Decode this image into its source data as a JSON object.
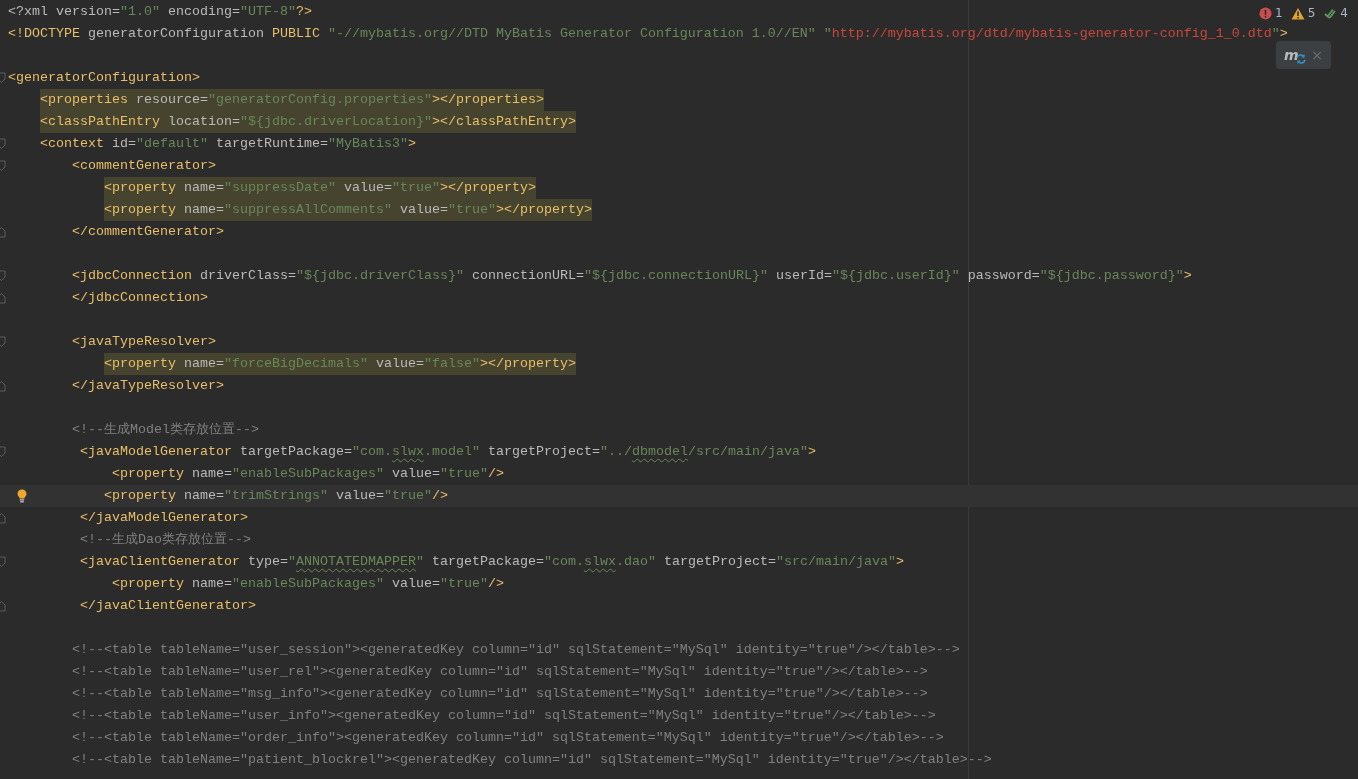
{
  "inspections": [
    {
      "kind": "error",
      "count": "1"
    },
    {
      "kind": "warning",
      "count": "5"
    },
    {
      "kind": "ok",
      "count": "4"
    }
  ],
  "reload_popup": {
    "logo": "m",
    "close": "×"
  },
  "lines": [
    {
      "current": false,
      "highlighted": false,
      "tokens": [
        {
          "kind": "plain",
          "text": "<?xml"
        },
        {
          "kind": "attr",
          "text": " version="
        },
        {
          "kind": "value",
          "text": "\"1.0\""
        },
        {
          "kind": "attr",
          "text": " encoding="
        },
        {
          "kind": "value",
          "text": "\"UTF-8\""
        },
        {
          "kind": "tag",
          "text": "?>"
        }
      ]
    },
    {
      "current": false,
      "highlighted": false,
      "tokens": [
        {
          "kind": "tag",
          "text": "<!DOCTYPE"
        },
        {
          "kind": "plain",
          "text": " generatorConfiguration "
        },
        {
          "kind": "tag",
          "text": "PUBLIC"
        },
        {
          "kind": "value",
          "text": " \"-//mybatis.org//DTD MyBatis Generator Configuration 1.0//EN\" \""
        },
        {
          "kind": "url",
          "text": "http://mybatis.org/dtd/mybatis-generator-config_1_0.dtd"
        },
        {
          "kind": "value",
          "text": "\""
        },
        {
          "kind": "tag",
          "text": ">"
        }
      ]
    },
    {
      "current": false
    },
    {
      "current": false,
      "highlighted": false,
      "fold": {
        "kind": "start"
      },
      "tokens": [
        {
          "kind": "tag",
          "text": "<generatorConfiguration>"
        }
      ]
    },
    {
      "current": false,
      "highlighted": true,
      "tokens": [
        {
          "kind": "tag",
          "text": "    <properties"
        },
        {
          "kind": "attr",
          "text": " resource="
        },
        {
          "kind": "value",
          "text": "\"generatorConfig.properties\""
        },
        {
          "kind": "tag",
          "text": "></properties>"
        }
      ]
    },
    {
      "current": false,
      "highlighted": true,
      "tokens": [
        {
          "kind": "tag",
          "text": "    <classPathEntry"
        },
        {
          "kind": "attr",
          "text": " location="
        },
        {
          "kind": "value",
          "text": "\"${jdbc.driverLocation}\""
        },
        {
          "kind": "tag",
          "text": "></classPathEntry>"
        }
      ]
    },
    {
      "current": false,
      "highlighted": false,
      "fold": {
        "kind": "start"
      },
      "tokens": [
        {
          "kind": "tag",
          "text": "    <context"
        },
        {
          "kind": "attr",
          "text": " id="
        },
        {
          "kind": "value",
          "text": "\"default\""
        },
        {
          "kind": "attr",
          "text": " targetRuntime="
        },
        {
          "kind": "value",
          "text": "\"MyBatis3\""
        },
        {
          "kind": "tag",
          "text": ">"
        }
      ]
    },
    {
      "current": false,
      "highlighted": false,
      "fold": {
        "kind": "start"
      },
      "tokens": [
        {
          "kind": "tag",
          "text": "        <commentGenerator>"
        }
      ]
    },
    {
      "current": false,
      "highlighted": true,
      "tokens": [
        {
          "kind": "tag",
          "text": "            <property"
        },
        {
          "kind": "attr",
          "text": " name="
        },
        {
          "kind": "value",
          "text": "\"suppressDate\""
        },
        {
          "kind": "attr",
          "text": " value="
        },
        {
          "kind": "value",
          "text": "\"true\""
        },
        {
          "kind": "tag",
          "text": "></property>"
        }
      ]
    },
    {
      "current": false,
      "highlighted": true,
      "tokens": [
        {
          "kind": "tag",
          "text": "            <property"
        },
        {
          "kind": "attr",
          "text": " name="
        },
        {
          "kind": "value",
          "text": "\"suppressAllComments\""
        },
        {
          "kind": "attr",
          "text": " value="
        },
        {
          "kind": "value",
          "text": "\"true\""
        },
        {
          "kind": "tag",
          "text": "></property>"
        }
      ]
    },
    {
      "current": false,
      "highlighted": false,
      "fold": {
        "kind": "end"
      },
      "tokens": [
        {
          "kind": "tag",
          "text": "        </commentGenerator>"
        }
      ]
    },
    {
      "current": false
    },
    {
      "current": false,
      "highlighted": false,
      "fold": {
        "kind": "start"
      },
      "tokens": [
        {
          "kind": "tag",
          "text": "        <jdbcConnection"
        },
        {
          "kind": "attr",
          "text": " driverClass="
        },
        {
          "kind": "value",
          "text": "\"${jdbc.driverClass}\""
        },
        {
          "kind": "attr",
          "text": " connectionURL="
        },
        {
          "kind": "value",
          "text": "\"${jdbc.connectionURL}\""
        },
        {
          "kind": "attr",
          "text": " userId="
        },
        {
          "kind": "value",
          "text": "\"${jdbc.userId}\""
        },
        {
          "kind": "attr",
          "text": " password="
        },
        {
          "kind": "value",
          "text": "\"${jdbc.password}\""
        },
        {
          "kind": "tag",
          "text": ">"
        }
      ]
    },
    {
      "current": false,
      "highlighted": false,
      "fold": {
        "kind": "end"
      },
      "tokens": [
        {
          "kind": "tag",
          "text": "        </jdbcConnection>"
        }
      ]
    },
    {
      "current": false
    },
    {
      "current": false,
      "highlighted": false,
      "fold": {
        "kind": "start"
      },
      "tokens": [
        {
          "kind": "tag",
          "text": "        <javaTypeResolver>"
        }
      ]
    },
    {
      "current": false,
      "highlighted": true,
      "tokens": [
        {
          "kind": "tag",
          "text": "            <property"
        },
        {
          "kind": "attr",
          "text": " name="
        },
        {
          "kind": "value",
          "text": "\"forceBigDecimals\""
        },
        {
          "kind": "attr",
          "text": " value="
        },
        {
          "kind": "value",
          "text": "\"false\""
        },
        {
          "kind": "tag",
          "text": "></property>"
        }
      ]
    },
    {
      "current": false,
      "highlighted": false,
      "fold": {
        "kind": "end"
      },
      "tokens": [
        {
          "kind": "tag",
          "text": "        </javaTypeResolver>"
        }
      ]
    },
    {
      "current": false
    },
    {
      "current": false,
      "highlighted": false,
      "tokens": [
        {
          "kind": "comment",
          "text": "        <!--生成Model类存放位置-->"
        }
      ]
    },
    {
      "current": false,
      "highlighted": false,
      "fold": {
        "kind": "start"
      },
      "tokens": [
        {
          "kind": "tag",
          "text": "         <javaModelGenerator"
        },
        {
          "kind": "attr",
          "text": " targetPackage="
        },
        {
          "kind": "value",
          "text": "\"com."
        },
        {
          "kind": "value",
          "text": "slwx",
          "typo": true
        },
        {
          "kind": "value",
          "text": ".model\""
        },
        {
          "kind": "attr",
          "text": " targetProject="
        },
        {
          "kind": "value",
          "text": "\"../"
        },
        {
          "kind": "value",
          "text": "dbmodel",
          "typo": true
        },
        {
          "kind": "value",
          "text": "/src/main/java\""
        },
        {
          "kind": "tag",
          "text": ">"
        }
      ]
    },
    {
      "current": false,
      "highlighted": false,
      "tokens": [
        {
          "kind": "tag",
          "text": "             <property"
        },
        {
          "kind": "attr",
          "text": " name="
        },
        {
          "kind": "value",
          "text": "\"enableSubPackages\""
        },
        {
          "kind": "attr",
          "text": " value="
        },
        {
          "kind": "value",
          "text": "\"true\""
        },
        {
          "kind": "tag",
          "text": "/>"
        }
      ]
    },
    {
      "current": true,
      "highlighted": false,
      "tokens": [
        {
          "kind": "tag",
          "text": "            <property"
        },
        {
          "kind": "attr",
          "text": " name="
        },
        {
          "kind": "value",
          "text": "\"trimStrings\""
        },
        {
          "kind": "attr",
          "text": " value="
        },
        {
          "kind": "value",
          "text": "\"true\""
        },
        {
          "kind": "tag",
          "text": "/>"
        }
      ]
    },
    {
      "current": false,
      "highlighted": false,
      "fold": {
        "kind": "end"
      },
      "tokens": [
        {
          "kind": "tag",
          "text": "         </javaModelGenerator>"
        }
      ]
    },
    {
      "current": false,
      "highlighted": false,
      "tokens": [
        {
          "kind": "comment",
          "text": "         <!--生成Dao类存放位置-->"
        }
      ]
    },
    {
      "current": false,
      "highlighted": false,
      "fold": {
        "kind": "start"
      },
      "tokens": [
        {
          "kind": "tag",
          "text": "         <javaClientGenerator"
        },
        {
          "kind": "attr",
          "text": " type="
        },
        {
          "kind": "value",
          "text": "\""
        },
        {
          "kind": "value",
          "text": "ANNOTATEDMAPPER",
          "typo": true
        },
        {
          "kind": "value",
          "text": "\""
        },
        {
          "kind": "attr",
          "text": " targetPackage="
        },
        {
          "kind": "value",
          "text": "\"com."
        },
        {
          "kind": "value",
          "text": "slwx",
          "typo": true
        },
        {
          "kind": "value",
          "text": ".dao\""
        },
        {
          "kind": "attr",
          "text": " targetProject="
        },
        {
          "kind": "value",
          "text": "\"src/main/java\""
        },
        {
          "kind": "tag",
          "text": ">"
        }
      ]
    },
    {
      "current": false,
      "highlighted": false,
      "tokens": [
        {
          "kind": "tag",
          "text": "             <property"
        },
        {
          "kind": "attr",
          "text": " name="
        },
        {
          "kind": "value",
          "text": "\"enableSubPackages\""
        },
        {
          "kind": "attr",
          "text": " value="
        },
        {
          "kind": "value",
          "text": "\"true\""
        },
        {
          "kind": "tag",
          "text": "/>"
        }
      ]
    },
    {
      "current": false,
      "highlighted": false,
      "fold": {
        "kind": "end"
      },
      "tokens": [
        {
          "kind": "tag",
          "text": "         </javaClientGenerator>"
        }
      ]
    },
    {
      "current": false
    },
    {
      "current": false,
      "highlighted": false,
      "tokens": [
        {
          "kind": "comment",
          "text": "        <!--<table tableName=\"user_session\"><generatedKey column=\"id\" sqlStatement=\"MySql\" identity=\"true\"/></table>-->"
        }
      ]
    },
    {
      "current": false,
      "highlighted": false,
      "tokens": [
        {
          "kind": "comment",
          "text": "        <!--<table tableName=\"user_rel\"><generatedKey column=\"id\" sqlStatement=\"MySql\" identity=\"true\"/></table>-->"
        }
      ]
    },
    {
      "current": false,
      "highlighted": false,
      "tokens": [
        {
          "kind": "comment",
          "text": "        <!--<table tableName=\"msg_info\"><generatedKey column=\"id\" sqlStatement=\"MySql\" identity=\"true\"/></table>-->"
        }
      ]
    },
    {
      "current": false,
      "highlighted": false,
      "tokens": [
        {
          "kind": "comment",
          "text": "        <!--<table tableName=\"user_info\"><generatedKey column=\"id\" sqlStatement=\"MySql\" identity=\"true\"/></table>-->"
        }
      ]
    },
    {
      "current": false,
      "highlighted": false,
      "tokens": [
        {
          "kind": "comment",
          "text": "        <!--<table tableName=\"order_info\"><generatedKey column=\"id\" sqlStatement=\"MySql\" identity=\"true\"/></table>-->"
        }
      ]
    },
    {
      "current": false,
      "highlighted": false,
      "tokens": [
        {
          "kind": "comment",
          "text": "        <!--<table tableName=\"patient_blockrel\"><generatedKey column=\"id\" sqlStatement=\"MySql\" identity=\"true\"/></table>-->"
        }
      ]
    }
  ]
}
